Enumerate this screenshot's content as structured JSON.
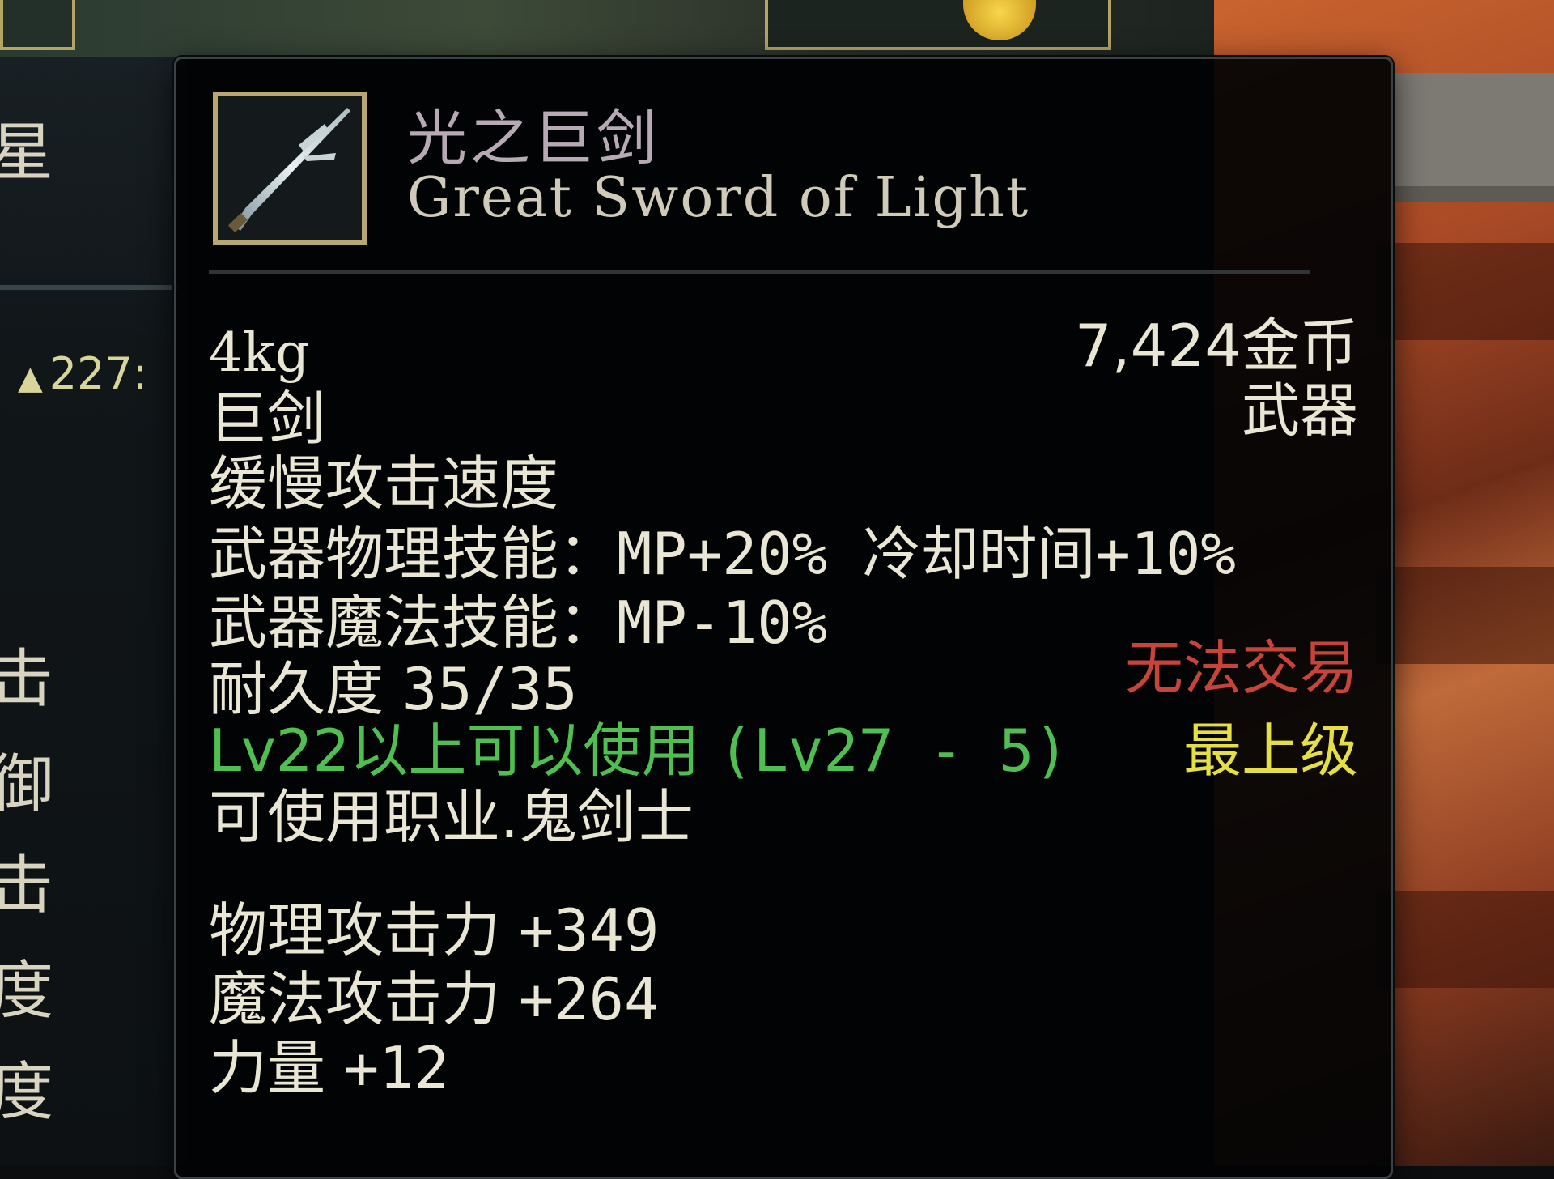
{
  "background": {
    "side_glyphs": [
      "星",
      "击",
      "御",
      "击",
      "度",
      "度"
    ],
    "side_stat": "227:"
  },
  "tooltip": {
    "name_cn": "光之巨剑",
    "name_en": "Great Sword of Light",
    "weight": "4kg",
    "price": "7,424金币",
    "subtype": "巨剑",
    "category": "武器",
    "attack_speed": "缓慢攻击速度",
    "physical_skill": {
      "label": "武器物理技能",
      "separator": "：",
      "value": "MP+20% 冷却时间+10%"
    },
    "magic_skill": {
      "label": "武器魔法技能",
      "separator": "：",
      "value": "MP-10%"
    },
    "durability": {
      "label": "耐久度",
      "value": "35/35"
    },
    "tradability": "无法交易",
    "level_requirement": {
      "main": "Lv22以上可以使用",
      "range": "(Lv27 - 5)"
    },
    "grade": "最上级",
    "usable_class": "可使用职业.鬼剑士",
    "stats": [
      {
        "label": "物理攻击力",
        "value": "+349"
      },
      {
        "label": "魔法攻击力",
        "value": "+264"
      },
      {
        "label": "力量",
        "value": "+12"
      }
    ]
  },
  "colors": {
    "name": "#b7aab5",
    "text": "#e9e6d3",
    "untradable": "#c8443a",
    "level_requirement": "#4fbf52",
    "grade": "#e5df44",
    "icon_border": "#b9a670"
  },
  "icon": "great-sword-icon"
}
